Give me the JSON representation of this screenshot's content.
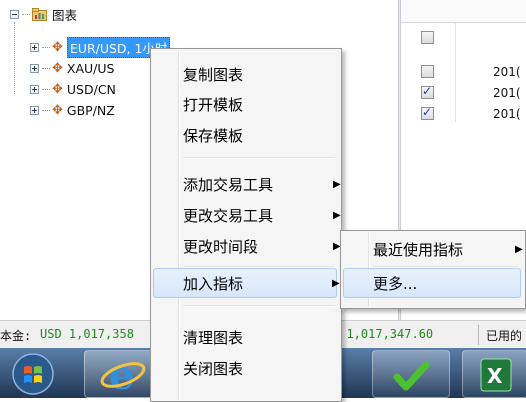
{
  "tree": {
    "root_label": "图表",
    "items": [
      {
        "label": "EUR/USD, 1小时",
        "selected": true
      },
      {
        "label": "XAU/US",
        "selected": false
      },
      {
        "label": "USD/CN",
        "selected": false
      },
      {
        "label": "GBP/NZ",
        "selected": false
      }
    ]
  },
  "grid": {
    "rows": [
      {
        "checked": false,
        "cell": ""
      },
      {
        "checked": false,
        "cell": "201("
      },
      {
        "checked": true,
        "cell": "201("
      },
      {
        "checked": true,
        "cell": "201("
      }
    ]
  },
  "context_menu": {
    "items": [
      {
        "label": "复制图表"
      },
      {
        "label": "打开模板"
      },
      {
        "label": "保存模板"
      },
      {
        "label": "添加交易工具"
      },
      {
        "label": "更改交易工具"
      },
      {
        "label": "更改时间段"
      },
      {
        "label": "加入指标"
      },
      {
        "label": "清理图表"
      },
      {
        "label": "关闭图表"
      }
    ],
    "arrow": "▶"
  },
  "submenu": {
    "items": [
      {
        "label": "最近使用指标"
      },
      {
        "label": "更多..."
      }
    ],
    "arrow": "▶"
  },
  "status_bar": {
    "left_label": "本金:",
    "left_value": "USD 1,017,358",
    "right_value": "D 1,017,347.60",
    "right_label": "已用的"
  },
  "colors": {
    "accent": "#3399ff",
    "status_green": "#1e8a1e",
    "menu_bg": "#f5f5f5",
    "highlight": "#d6e7fb"
  },
  "taskbar": {
    "icons": [
      "windows-start-icon",
      "internet-explorer-icon",
      "checkmark-app-icon",
      "excel-icon"
    ]
  }
}
